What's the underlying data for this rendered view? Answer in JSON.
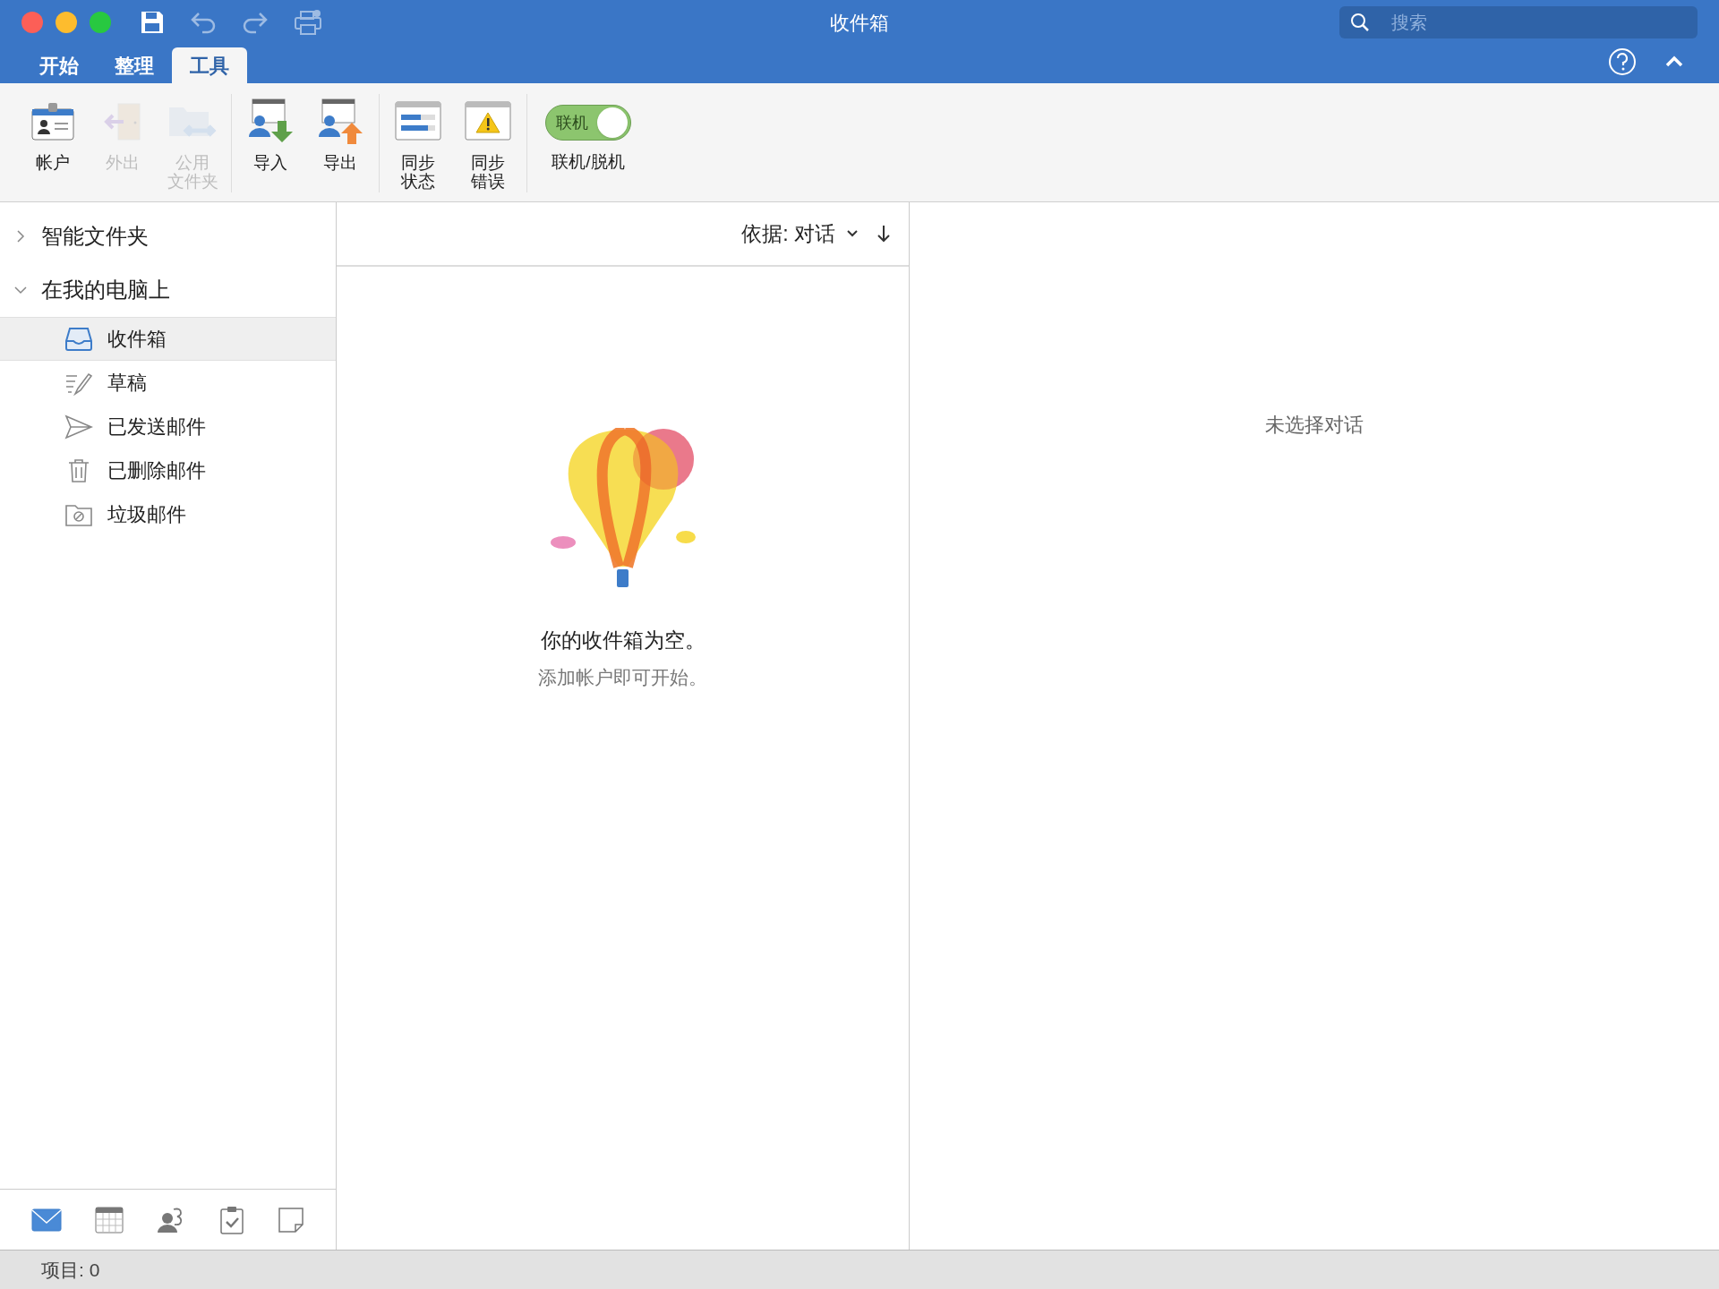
{
  "window": {
    "title": "收件箱"
  },
  "search": {
    "placeholder": "搜索"
  },
  "tabs": [
    {
      "label": "开始",
      "selected": false
    },
    {
      "label": "整理",
      "selected": false
    },
    {
      "label": "工具",
      "selected": true
    }
  ],
  "ribbon": {
    "groups": [
      {
        "items": [
          {
            "kind": "button",
            "lines": [
              "帐户"
            ],
            "disabled": false
          },
          {
            "kind": "button",
            "lines": [
              "外出"
            ],
            "disabled": true
          },
          {
            "kind": "button",
            "lines": [
              "公用",
              "文件夹"
            ],
            "disabled": true
          }
        ]
      },
      {
        "items": [
          {
            "kind": "button",
            "lines": [
              "导入"
            ],
            "disabled": false
          },
          {
            "kind": "button",
            "lines": [
              "导出"
            ],
            "disabled": false
          }
        ]
      },
      {
        "items": [
          {
            "kind": "button",
            "lines": [
              "同步",
              "状态"
            ],
            "disabled": false
          },
          {
            "kind": "button",
            "lines": [
              "同步",
              "错误"
            ],
            "disabled": false
          }
        ]
      },
      {
        "items": [
          {
            "kind": "toggle",
            "switch_label": "联机",
            "lines": [
              "联机/脱机"
            ],
            "on": true
          }
        ]
      }
    ]
  },
  "sidebar": {
    "sections": [
      {
        "label": "智能文件夹",
        "expanded": false
      },
      {
        "label": "在我的电脑上",
        "expanded": true,
        "children": [
          {
            "label": "收件箱",
            "selected": true
          },
          {
            "label": "草稿",
            "selected": false
          },
          {
            "label": "已发送邮件",
            "selected": false
          },
          {
            "label": "已删除邮件",
            "selected": false
          },
          {
            "label": "垃圾邮件",
            "selected": false
          }
        ]
      }
    ]
  },
  "nav": [
    {
      "selected": true
    },
    {
      "selected": false
    },
    {
      "selected": false
    },
    {
      "selected": false
    },
    {
      "selected": false
    }
  ],
  "list": {
    "sort": "依据: 对话",
    "empty_title": "你的收件箱为空。",
    "empty_hint": "添加帐户即可开始。"
  },
  "reading": {
    "empty": "未选择对话"
  },
  "status_bar": {
    "text": "项目: 0"
  }
}
